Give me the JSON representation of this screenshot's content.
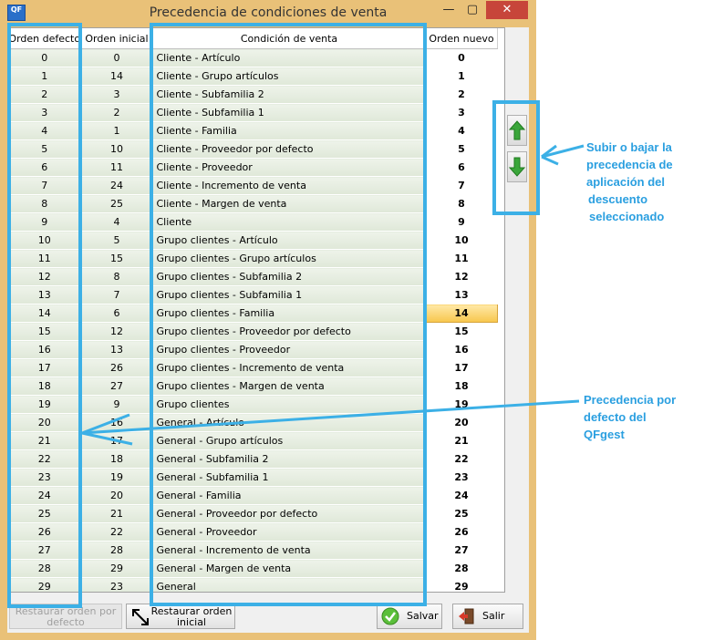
{
  "window": {
    "app_icon_text": "QF",
    "title": "Precedencia de condiciones de venta",
    "minimize_glyph": "—",
    "maximize_glyph": "▢",
    "close_glyph": "✕"
  },
  "grid": {
    "headers": [
      "Orden defecto",
      "Orden inicial",
      "Condición de venta",
      "Orden nuevo"
    ],
    "selected_row": 14,
    "rows": [
      {
        "default": "0",
        "initial": "0",
        "condition": "Cliente - Artículo",
        "new": "0"
      },
      {
        "default": "1",
        "initial": "14",
        "condition": "Cliente - Grupo artículos",
        "new": "1"
      },
      {
        "default": "2",
        "initial": "3",
        "condition": "Cliente - Subfamilia 2",
        "new": "2"
      },
      {
        "default": "3",
        "initial": "2",
        "condition": "Cliente - Subfamilia 1",
        "new": "3"
      },
      {
        "default": "4",
        "initial": "1",
        "condition": "Cliente - Familia",
        "new": "4"
      },
      {
        "default": "5",
        "initial": "10",
        "condition": "Cliente - Proveedor por defecto",
        "new": "5"
      },
      {
        "default": "6",
        "initial": "11",
        "condition": "Cliente - Proveedor",
        "new": "6"
      },
      {
        "default": "7",
        "initial": "24",
        "condition": "Cliente - Incremento de venta",
        "new": "7"
      },
      {
        "default": "8",
        "initial": "25",
        "condition": "Cliente - Margen de venta",
        "new": "8"
      },
      {
        "default": "9",
        "initial": "4",
        "condition": "Cliente",
        "new": "9"
      },
      {
        "default": "10",
        "initial": "5",
        "condition": "Grupo clientes - Artículo",
        "new": "10"
      },
      {
        "default": "11",
        "initial": "15",
        "condition": "Grupo clientes - Grupo artículos",
        "new": "11"
      },
      {
        "default": "12",
        "initial": "8",
        "condition": "Grupo clientes - Subfamilia 2",
        "new": "12"
      },
      {
        "default": "13",
        "initial": "7",
        "condition": "Grupo clientes - Subfamilia 1",
        "new": "13"
      },
      {
        "default": "14",
        "initial": "6",
        "condition": "Grupo clientes - Familia",
        "new": "14"
      },
      {
        "default": "15",
        "initial": "12",
        "condition": "Grupo clientes - Proveedor por defecto",
        "new": "15"
      },
      {
        "default": "16",
        "initial": "13",
        "condition": "Grupo clientes - Proveedor",
        "new": "16"
      },
      {
        "default": "17",
        "initial": "26",
        "condition": "Grupo clientes - Incremento de venta",
        "new": "17"
      },
      {
        "default": "18",
        "initial": "27",
        "condition": "Grupo clientes - Margen de venta",
        "new": "18"
      },
      {
        "default": "19",
        "initial": "9",
        "condition": "Grupo clientes",
        "new": "19"
      },
      {
        "default": "20",
        "initial": "16",
        "condition": "General - Artículo",
        "new": "20"
      },
      {
        "default": "21",
        "initial": "17",
        "condition": "General - Grupo artículos",
        "new": "21"
      },
      {
        "default": "22",
        "initial": "18",
        "condition": "General - Subfamilia 2",
        "new": "22"
      },
      {
        "default": "23",
        "initial": "19",
        "condition": "General - Subfamilia 1",
        "new": "23"
      },
      {
        "default": "24",
        "initial": "20",
        "condition": "General - Familia",
        "new": "24"
      },
      {
        "default": "25",
        "initial": "21",
        "condition": "General - Proveedor por defecto",
        "new": "25"
      },
      {
        "default": "26",
        "initial": "22",
        "condition": "General - Proveedor",
        "new": "26"
      },
      {
        "default": "27",
        "initial": "28",
        "condition": "General - Incremento de venta",
        "new": "27"
      },
      {
        "default": "28",
        "initial": "29",
        "condition": "General - Margen de venta",
        "new": "28"
      },
      {
        "default": "29",
        "initial": "23",
        "condition": "General",
        "new": "29"
      }
    ]
  },
  "buttons": {
    "restore_default": "Restaurar orden por defecto",
    "restore_initial": "Restaurar orden inicial",
    "save": "Salvar",
    "exit": "Salir"
  },
  "annotations": {
    "move_note": [
      "Subir o bajar la",
      "precedencia de",
      "aplicación del",
      "descuento",
      "seleccionado"
    ],
    "default_note": [
      "Precedencia por",
      "defecto del",
      "QFgest"
    ]
  },
  "colors": {
    "accent": "#3cb0e6",
    "arrow_up": "#3aa63a",
    "arrow_down": "#3aa63a",
    "selection": "#f7c64c"
  }
}
